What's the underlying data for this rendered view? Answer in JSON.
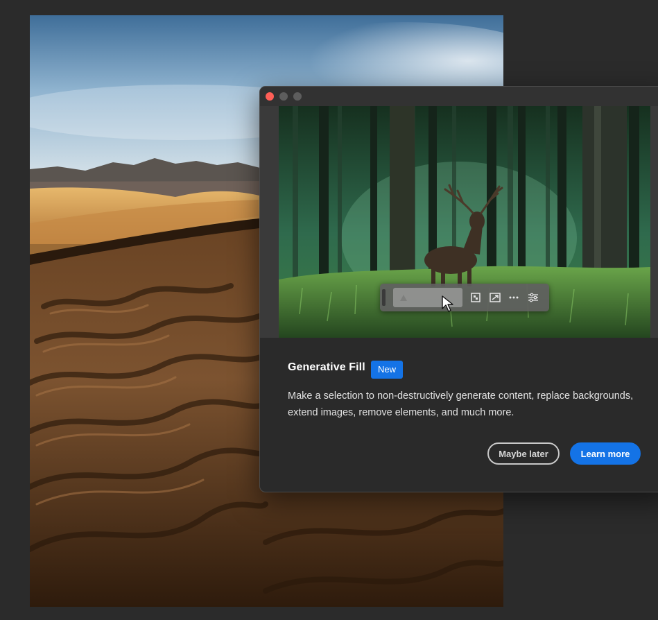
{
  "canvas": {
    "image": "desert-dunes-photo"
  },
  "dialog": {
    "window_controls": [
      "close",
      "minimize",
      "maximize"
    ],
    "hero_image": "forest-stag-photo",
    "taskbar": {
      "icons": [
        "generative-fill-icon",
        "expand-image-icon",
        "more-options-icon",
        "adjustments-icon"
      ]
    },
    "title": "Generative Fill",
    "badge": "New",
    "description": "Make a selection to non-destructively generate content, replace backgrounds, extend images, remove elements, and much more.",
    "buttons": {
      "secondary": "Maybe later",
      "primary": "Learn more"
    }
  },
  "colors": {
    "accent": "#1473e6",
    "background": "#2b2b2b",
    "dialog": "#2a2a2a"
  }
}
